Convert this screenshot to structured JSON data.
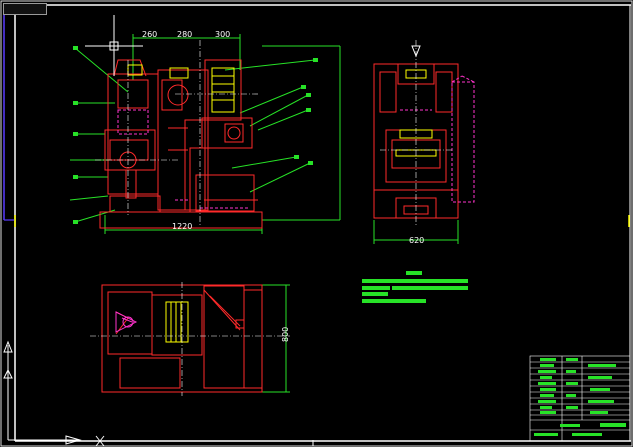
{
  "window": {
    "tab_label": ""
  },
  "dimensions": {
    "top_260": "260",
    "top_280": "280",
    "top_300": "300",
    "width_1220": "1220",
    "side_620": "620",
    "plan_800": "800"
  },
  "colors": {
    "background": "#000000",
    "frame": "#ffffff",
    "frame_outer": "#d4d4d4",
    "part": "#ff2a2a",
    "dimension": "#27e227",
    "centerline": "#ffffff",
    "hidden": "#ff33cc",
    "highlight": "#ffff00",
    "crosshair": "#ffffff",
    "axis": "#ffffff",
    "vertical_bar": "#5a3cff"
  },
  "icons": {
    "ucs": "ucs-icon",
    "crosshair": "crosshair-cursor-icon"
  }
}
